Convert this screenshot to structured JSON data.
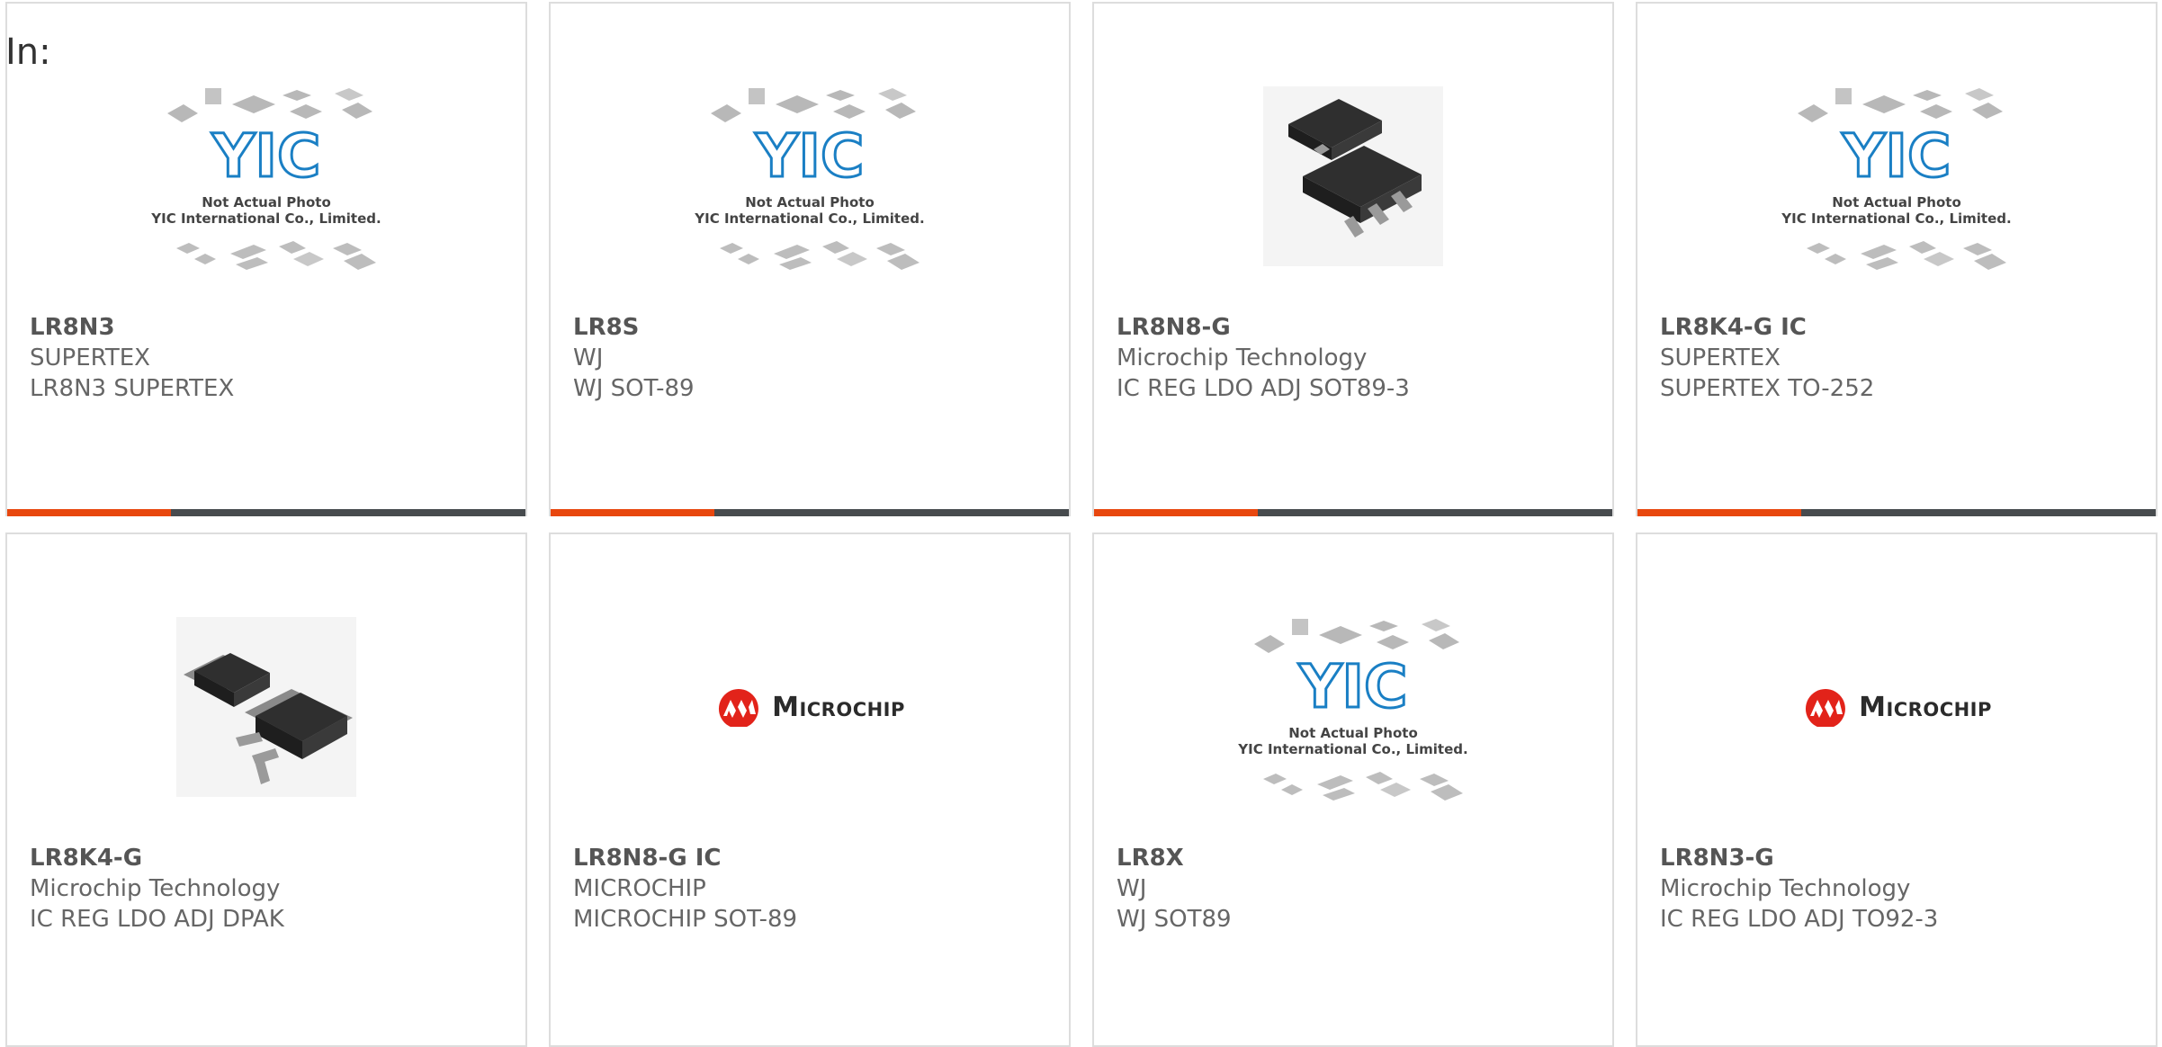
{
  "page": {
    "label": "In:"
  },
  "products": [
    {
      "part": "LR8N3",
      "manufacturer": "SUPERTEX",
      "description": "LR8N3 SUPERTEX",
      "image": "yic-placeholder"
    },
    {
      "part": "LR8S",
      "manufacturer": "WJ",
      "description": "WJ SOT-89",
      "image": "yic-placeholder"
    },
    {
      "part": "LR8N8-G",
      "manufacturer": "Microchip Technology",
      "description": "IC REG LDO ADJ SOT89-3",
      "image": "sot89-package"
    },
    {
      "part": "LR8K4-G IC",
      "manufacturer": "SUPERTEX",
      "description": "SUPERTEX TO-252",
      "image": "yic-placeholder"
    },
    {
      "part": "LR8K4-G",
      "manufacturer": "Microchip Technology",
      "description": "IC REG LDO ADJ DPAK",
      "image": "dpak-package"
    },
    {
      "part": "LR8N8-G IC",
      "manufacturer": "MICROCHIP",
      "description": "MICROCHIP SOT-89",
      "image": "microchip-logo"
    },
    {
      "part": "LR8X",
      "manufacturer": "WJ",
      "description": "WJ SOT89",
      "image": "yic-placeholder"
    },
    {
      "part": "LR8N3-G",
      "manufacturer": "Microchip Technology",
      "description": "IC REG LDO ADJ TO92-3",
      "image": "microchip-logo"
    }
  ],
  "placeholder": {
    "line1": "Not Actual Photo",
    "line2": "YIC International Co., Limited."
  },
  "logo": {
    "microchip_text": "Microchip"
  },
  "colors": {
    "accent": "#e8470e",
    "bar": "#474b4e",
    "border": "#dddddd",
    "yic_blue": "#1a7fc4",
    "microchip_red": "#e2231a"
  }
}
